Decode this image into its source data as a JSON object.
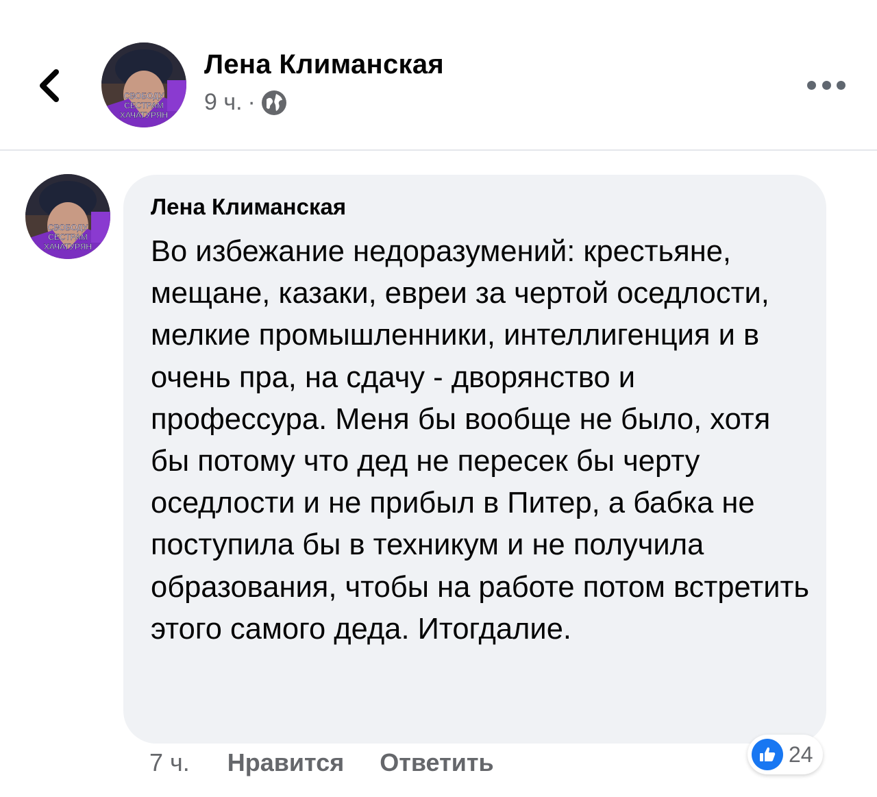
{
  "post_header": {
    "author": "Лена Климанская",
    "time": "9 ч.",
    "separator": "·",
    "avatar_caption": [
      "СВОБОДУ",
      "СЕСТРАМ",
      "ХАЧАТУРЯН"
    ]
  },
  "comment": {
    "author": "Лена Климанская",
    "text": "Во избежание недоразумений: крестьяне, мещане, казаки, евреи за чертой оседлости, мелкие промышленники, интеллигенция и в очень пра, на сдачу - дворянство и профессура. Меня бы вообще не было, хотя бы потому что дед не пересек бы черту оседлости и не прибыл в Питер, а бабка не поступила бы в техникум и не получила образования, чтобы на работе потом встретить этого самого деда. Итогдалие.",
    "time": "7 ч.",
    "like_label": "Нравится",
    "reply_label": "Ответить",
    "reaction_count": "24",
    "reaction_icon": "thumbs-up-icon"
  },
  "colors": {
    "brand": "#1877f2",
    "bubble": "#f0f2f5",
    "muted_text": "#65676b",
    "avatar_accent": "#7b2fc0"
  }
}
